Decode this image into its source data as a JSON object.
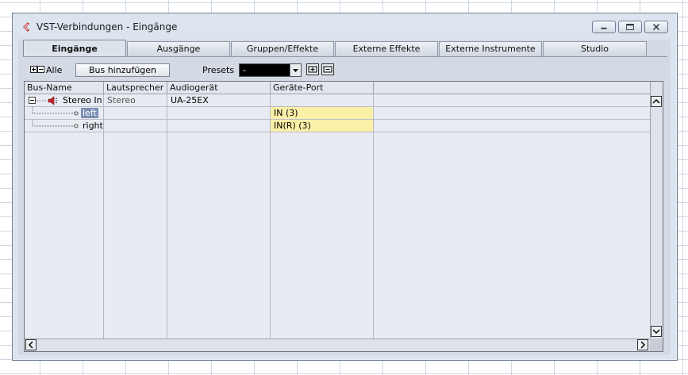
{
  "window": {
    "title": "VST-Verbindungen - Eingänge",
    "accent_color": "#c0262b"
  },
  "tabs": [
    {
      "label": "Eingänge",
      "active": true
    },
    {
      "label": "Ausgänge",
      "active": false
    },
    {
      "label": "Gruppen/Effekte",
      "active": false
    },
    {
      "label": "Externe Effekte",
      "active": false
    },
    {
      "label": "Externe Instrumente",
      "active": false
    },
    {
      "label": "Studio",
      "active": false
    }
  ],
  "toolbar": {
    "all_label": "Alle",
    "add_bus_label": "Bus hinzufügen",
    "presets_label": "Presets",
    "presets_value": "-"
  },
  "table": {
    "columns": [
      "Bus-Name",
      "Lautsprecher",
      "Audiogerät",
      "Geräte-Port",
      ""
    ],
    "rows": [
      {
        "bus": "Stereo In",
        "speaker": "Stereo",
        "device": "UA-25EX",
        "port": ""
      },
      {
        "bus": "left",
        "speaker": "",
        "device": "",
        "port": "IN (3)"
      },
      {
        "bus": "right",
        "speaker": "",
        "device": "",
        "port": "IN(R) (3)"
      }
    ],
    "highlight_color": "#fbf0a8"
  }
}
